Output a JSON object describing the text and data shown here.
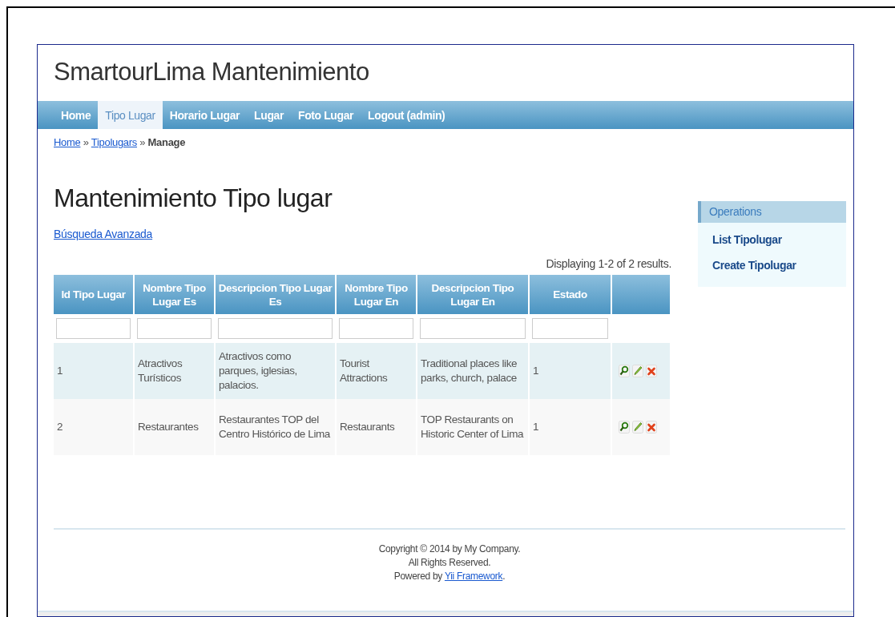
{
  "header": {
    "title": "SmartourLima Mantenimiento"
  },
  "nav": [
    {
      "label": "Home",
      "selected": false
    },
    {
      "label": "Tipo Lugar",
      "selected": true
    },
    {
      "label": "Horario Lugar",
      "selected": false
    },
    {
      "label": "Lugar",
      "selected": false
    },
    {
      "label": "Foto Lugar",
      "selected": false
    },
    {
      "label": "Logout (admin)",
      "selected": false
    }
  ],
  "breadcrumb": {
    "links": [
      "Home",
      "Tipolugars"
    ],
    "separator": "»",
    "current": "Manage"
  },
  "page_title": "Mantenimiento Tipo lugar",
  "advanced_search": "Búsqueda Avanzada",
  "summary": "Displaying 1-2 of 2 results.",
  "table": {
    "columns": [
      "Id Tipo Lugar",
      "Nombre Tipo Lugar Es",
      "Descripcion Tipo Lugar Es",
      "Nombre Tipo Lugar En",
      "Descripcion Tipo Lugar En",
      "Estado"
    ],
    "rows": [
      {
        "cells": [
          "1",
          "Atractivos Turísticos",
          "Atractivos como parques, iglesias, palacios.",
          "Tourist Attractions",
          "Traditional places like parks, church, palace",
          "1"
        ]
      },
      {
        "cells": [
          "2",
          "Restaurantes",
          "Restaurantes TOP del Centro Histórico de Lima",
          "Restaurants",
          "TOP Restaurants on Historic Center of Lima",
          "1"
        ]
      }
    ]
  },
  "sidebar": {
    "title": "Operations",
    "items": [
      "List Tipolugar",
      "Create Tipolugar"
    ]
  },
  "footer": {
    "lines": [
      "Copyright © 2014 by My Company.",
      "All Rights Reserved."
    ],
    "powered_prefix": "Powered by ",
    "powered_link": "Yii Framework",
    "powered_suffix": "."
  }
}
